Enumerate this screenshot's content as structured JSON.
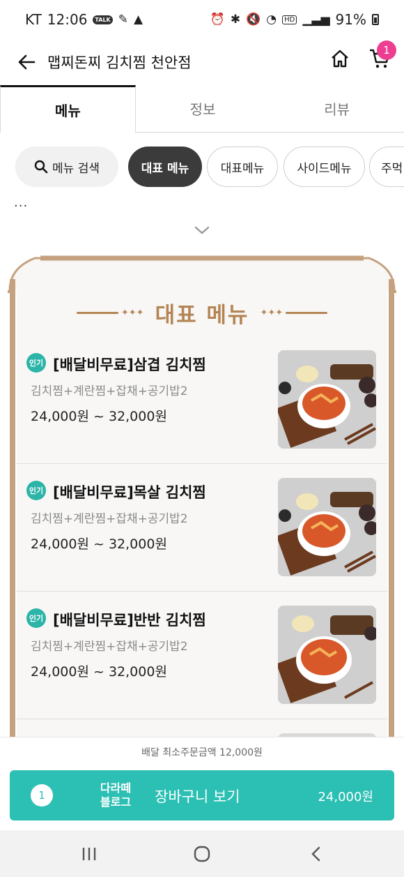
{
  "status_bar": {
    "carrier": "KT",
    "time": "12:06",
    "talk": "TALK",
    "hd": "HD",
    "battery": "91%"
  },
  "header": {
    "title": "맵찌돈찌 김치찜 천안점",
    "cart_count": "1"
  },
  "tabs": [
    {
      "label": "메뉴"
    },
    {
      "label": "정보"
    },
    {
      "label": "리뷰"
    }
  ],
  "chips": {
    "search_label": "메뉴 검색",
    "items": [
      {
        "label": "대표 메뉴"
      },
      {
        "label": "대표메뉴"
      },
      {
        "label": "사이드메뉴"
      },
      {
        "label": "주먹"
      }
    ]
  },
  "ellipsis": "...",
  "section": {
    "title": "대표 메뉴",
    "items": [
      {
        "badge": "인기",
        "name": "[배달비무료]삼겹 김치찜",
        "desc": "김치찜+계란찜+잡채+공기밥2",
        "price": "24,000원 ~ 32,000원"
      },
      {
        "badge": "인기",
        "name": "[배달비무료]목살 김치찜",
        "desc": "김치찜+계란찜+잡채+공기밥2",
        "price": "24,000원 ~ 32,000원"
      },
      {
        "badge": "인기",
        "name": "[배달비무료]반반 김치찜",
        "desc": "김치찜+계란찜+잡채+공기밥2",
        "price": "24,000원 ~ 32,000원"
      }
    ]
  },
  "order_bar": {
    "min_order": "배달 최소주문금액 12,000원",
    "count": "1",
    "logo_line1": "다라떼",
    "logo_line2": "블로그",
    "label": "장바구니 보기",
    "total": "24,000원"
  },
  "colors": {
    "accent": "#2cbfb3",
    "badge": "#ee3e92",
    "gold": "#c5a27f",
    "popular": "#2bb4a7"
  }
}
